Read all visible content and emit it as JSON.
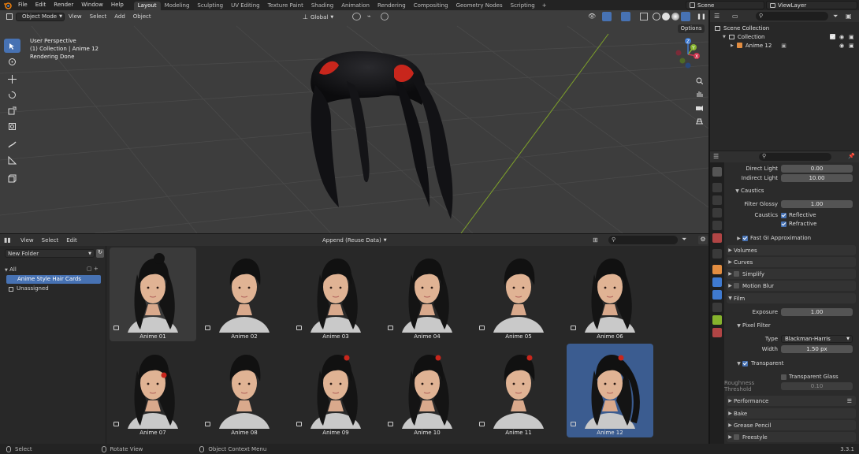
{
  "topbar": {
    "menus": [
      "File",
      "Edit",
      "Render",
      "Window",
      "Help"
    ],
    "workspaces": [
      "Layout",
      "Modeling",
      "Sculpting",
      "UV Editing",
      "Texture Paint",
      "Shading",
      "Animation",
      "Rendering",
      "Compositing",
      "Geometry Nodes",
      "Scripting"
    ],
    "active_workspace": "Layout",
    "add_tab": "+",
    "scene": "Scene",
    "view_layer": "ViewLayer"
  },
  "viewport": {
    "mode": "Object Mode",
    "menus": [
      "View",
      "Select",
      "Add",
      "Object"
    ],
    "orientation": "Global",
    "overlay_lines": [
      "User Perspective",
      "(1) Collection | Anime 12",
      "Rendering Done"
    ],
    "options_label": "Options",
    "gizmo_labels": {
      "x": "X",
      "y": "Y",
      "z": "Z"
    }
  },
  "asset_browser": {
    "menus": [
      "View",
      "Select",
      "Edit"
    ],
    "import_mode": "Append (Reuse Data)",
    "library": "New Folder",
    "catalogs": [
      "All",
      "Anime Style Hair Cards",
      "Unassigned"
    ],
    "selected_catalog": "Anime Style Hair Cards",
    "assets": [
      "Anime 01",
      "Anime 02",
      "Anime 03",
      "Anime 04",
      "Anime 05",
      "Anime 06",
      "Anime 07",
      "Anime 08",
      "Anime 09",
      "Anime 10",
      "Anime 11",
      "Anime 12"
    ],
    "selected_asset": "Anime 12"
  },
  "outliner": {
    "scene_collection": "Scene Collection",
    "collection": "Collection",
    "object": "Anime 12"
  },
  "properties": {
    "direct_light_label": "Direct Light",
    "direct_light": "0.00",
    "indirect_light_label": "Indirect Light",
    "indirect_light": "10.00",
    "caustics_panel": "Caustics",
    "filter_glossy_label": "Filter Glossy",
    "filter_glossy": "1.00",
    "caustics_label": "Caustics",
    "reflective": "Reflective",
    "refractive": "Refractive",
    "fast_gi": "Fast GI Approximation",
    "volumes": "Volumes",
    "curves": "Curves",
    "simplify": "Simplify",
    "motion_blur": "Motion Blur",
    "film": "Film",
    "exposure_label": "Exposure",
    "exposure": "1.00",
    "pixel_filter": "Pixel Filter",
    "type_label": "Type",
    "type_value": "Blackman-Harris",
    "width_label": "Width",
    "width_value": "1.50 px",
    "transparent": "Transparent",
    "transparent_glass": "Transparent Glass",
    "roughness_label": "Roughness Threshold",
    "roughness": "0.10",
    "performance": "Performance",
    "bake": "Bake",
    "grease_pencil": "Grease Pencil",
    "freestyle": "Freestyle"
  },
  "statusbar": {
    "select": "Select",
    "rotate": "Rotate View",
    "context": "Object Context Menu",
    "version": "3.3.1"
  },
  "colors": {
    "accent": "#4772b3",
    "selected_tile": "#3b5c90",
    "viewport_bg": "#3d3d3d",
    "hair_accent": "#c8261c"
  }
}
